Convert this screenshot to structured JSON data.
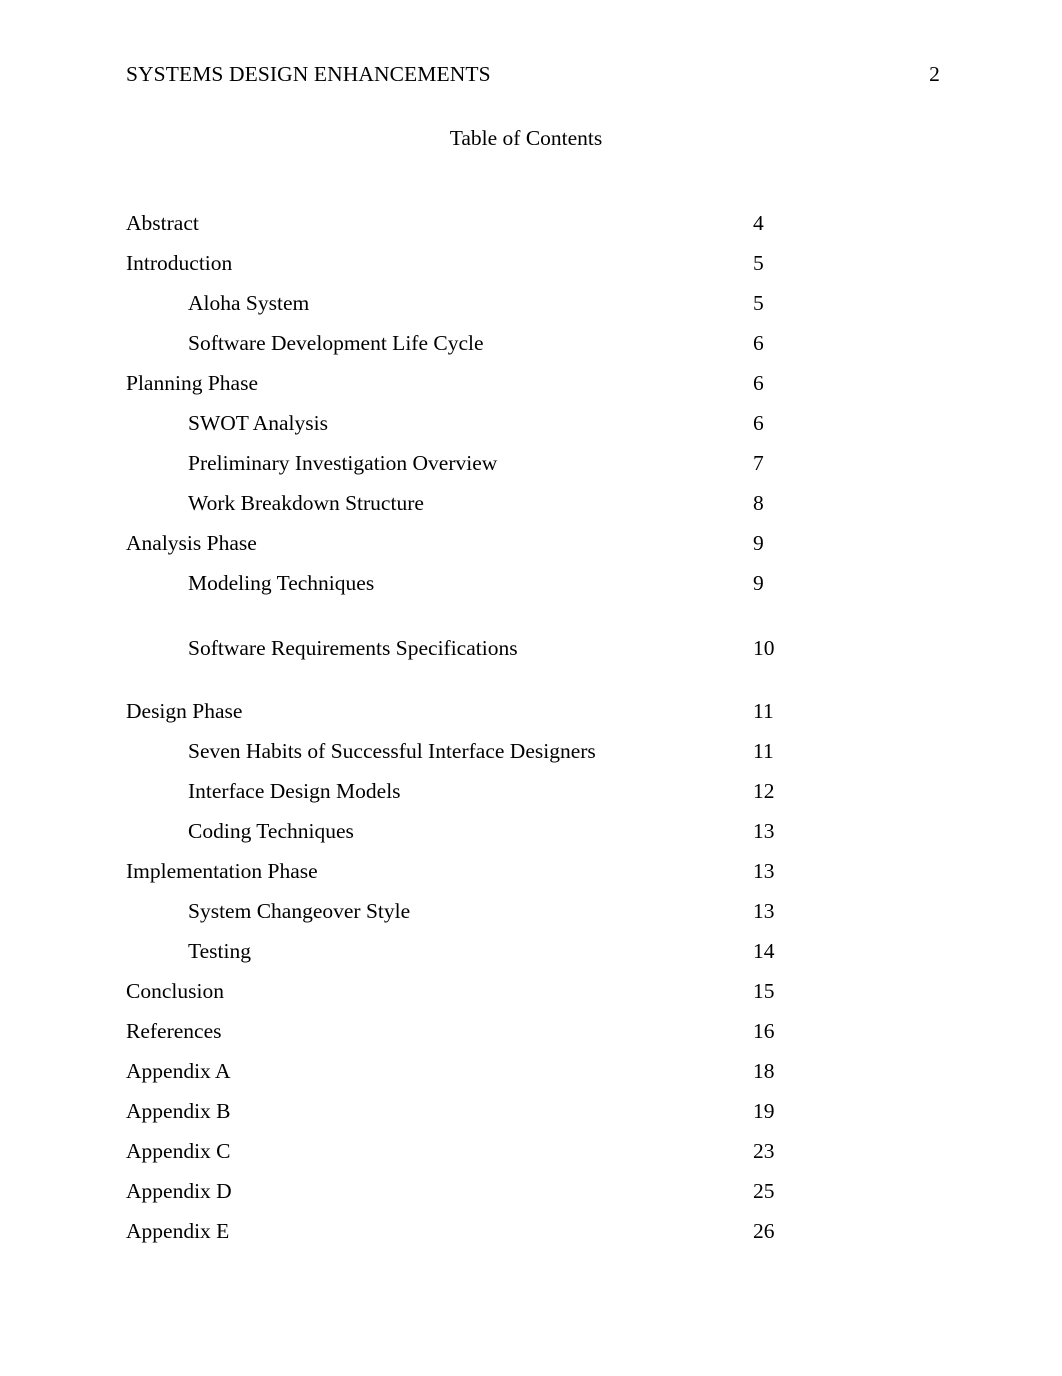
{
  "header": {
    "running_title": "SYSTEMS DESIGN ENHANCEMENTS",
    "page_number": "2"
  },
  "title": "Table of Contents",
  "toc": {
    "entries": [
      {
        "label": "Abstract",
        "page": "4",
        "level": 1
      },
      {
        "label": "Introduction",
        "page": "5",
        "level": 1
      },
      {
        "label": "Aloha System",
        "page": "5",
        "level": 2
      },
      {
        "label": "Software Development Life Cycle",
        "page": "6",
        "level": 2
      },
      {
        "label": "Planning Phase",
        "page": "6",
        "level": 1
      },
      {
        "label": "SWOT Analysis",
        "page": "6",
        "level": 2
      },
      {
        "label": "Preliminary Investigation Overview",
        "page": "7",
        "level": 2
      },
      {
        "label": "Work Breakdown Structure",
        "page": "8",
        "level": 2
      },
      {
        "label": "Analysis Phase",
        "page": "9",
        "level": 1
      },
      {
        "label": "Modeling Techniques",
        "page": "9",
        "level": 2
      },
      {
        "label": "Software Requirements Specifications",
        "page": "10",
        "level": 2,
        "gap_before": true,
        "gap_after": true
      },
      {
        "label": "Design Phase",
        "page": "11",
        "level": 1
      },
      {
        "label": "Seven Habits of Successful Interface Designers",
        "page": "11",
        "level": 2
      },
      {
        "label": "Interface Design Models",
        "page": "12",
        "level": 2
      },
      {
        "label": "Coding Techniques",
        "page": "13",
        "level": 2
      },
      {
        "label": "Implementation Phase",
        "page": "13",
        "level": 1
      },
      {
        "label": "System Changeover Style",
        "page": "13",
        "level": 2
      },
      {
        "label": "Testing",
        "page": "14",
        "level": 2
      },
      {
        "label": "Conclusion",
        "page": "15",
        "level": 1
      },
      {
        "label": "References",
        "page": "16",
        "level": 1
      },
      {
        "label": "Appendix A",
        "page": "18",
        "level": 1
      },
      {
        "label": "Appendix B",
        "page": "19",
        "level": 1
      },
      {
        "label": "Appendix C",
        "page": "23",
        "level": 1
      },
      {
        "label": "Appendix D",
        "page": "25",
        "level": 1
      },
      {
        "label": "Appendix E",
        "page": "26",
        "level": 1
      }
    ]
  },
  "colors": {
    "text": "#000000",
    "background": "#ffffff"
  }
}
